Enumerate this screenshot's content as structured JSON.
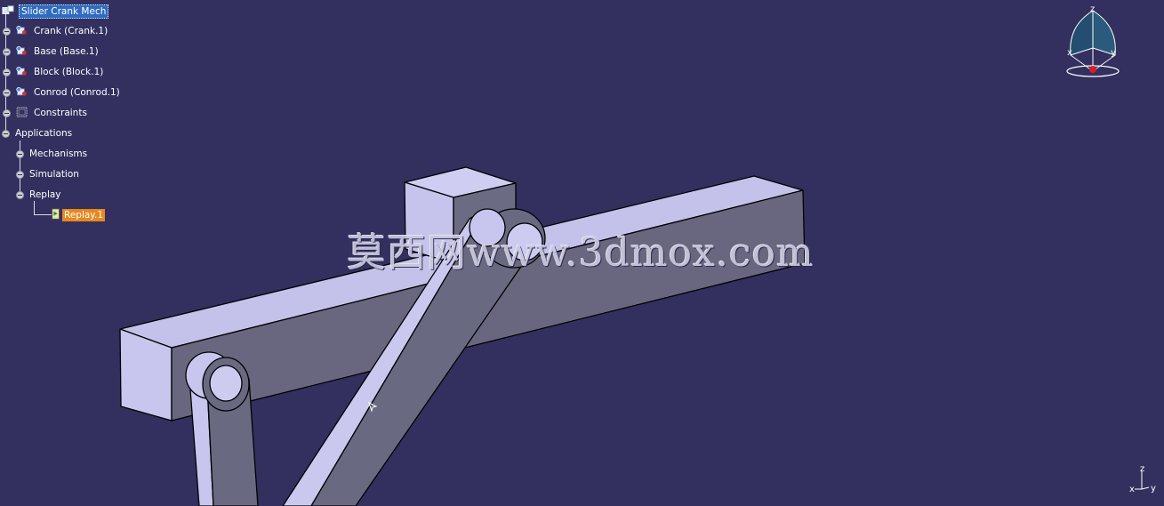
{
  "tree": {
    "root": "Slider Crank Mech",
    "parts": [
      {
        "label": "Crank (Crank.1)"
      },
      {
        "label": "Base (Base.1)"
      },
      {
        "label": "Block (Block.1)"
      },
      {
        "label": "Conrod (Conrod.1)"
      }
    ],
    "constraints": "Constraints",
    "applications": "Applications",
    "app_children": [
      {
        "label": "Mechanisms"
      },
      {
        "label": "Simulation"
      },
      {
        "label": "Replay"
      }
    ],
    "replay_item": "Replay.1"
  },
  "watermark": "莫西网www.3dmox.com",
  "compass": {
    "top": "z",
    "left": "x",
    "right": "y"
  },
  "mini_axis": {
    "z": "z",
    "x": "x",
    "y": "y"
  },
  "colors": {
    "background": "#33305f",
    "part_light": "#c8c6ec",
    "part_dark": "#6b6a80",
    "selection": "#e8871e"
  }
}
